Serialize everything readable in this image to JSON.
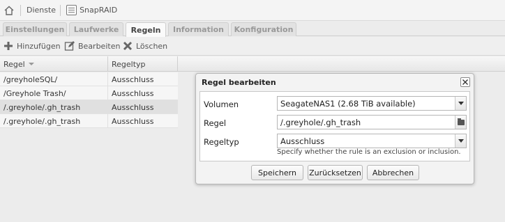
{
  "breadcrumb": {
    "home": "home-icon",
    "items": [
      "Dienste",
      "SnapRAID"
    ]
  },
  "tabs": [
    {
      "label": "Einstellungen",
      "active": false
    },
    {
      "label": "Laufwerke",
      "active": false
    },
    {
      "label": "Regeln",
      "active": true
    },
    {
      "label": "Information",
      "active": false
    },
    {
      "label": "Konfiguration",
      "active": false
    }
  ],
  "toolbar": {
    "add_label": "Hinzufügen",
    "edit_label": "Bearbeiten",
    "delete_label": "Löschen"
  },
  "grid": {
    "columns": [
      "Regel",
      "Regeltyp"
    ],
    "rows": [
      {
        "rule": "/greyholeSQL/",
        "type": "Ausschluss",
        "selected": false
      },
      {
        "rule": "/Greyhole Trash/",
        "type": "Ausschluss",
        "selected": false
      },
      {
        "rule": "/.greyhole/.gh_trash",
        "type": "Ausschluss",
        "selected": true
      },
      {
        "rule": "/.greyhole/.gh_trash",
        "type": "Ausschluss",
        "selected": false
      }
    ]
  },
  "dialog": {
    "title": "Regel bearbeiten",
    "fields": {
      "volume_label": "Volumen",
      "volume_value": "SeagateNAS1 (2.68 TiB available)",
      "rule_label": "Regel",
      "rule_value": "/.greyhole/.gh_trash",
      "type_label": "Regeltyp",
      "type_value": "Ausschluss",
      "type_help": "Specify whether the rule is an exclusion or inclusion."
    },
    "buttons": {
      "save": "Speichern",
      "reset": "Zurücksetzen",
      "cancel": "Abbrechen"
    }
  },
  "colors": {
    "background": "#ececec",
    "dialog_bg": "#f3f3f3",
    "selected_row": "#e0e0e0",
    "active_tab": "#fafafa"
  }
}
